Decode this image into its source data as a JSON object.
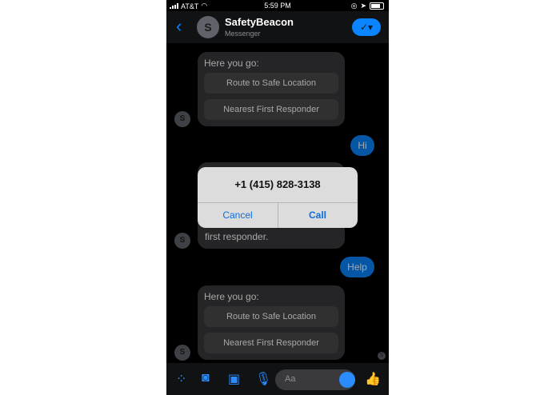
{
  "status": {
    "carrier": "AT&T",
    "time": "5:59 PM"
  },
  "header": {
    "title": "SafetyBeacon",
    "subtitle": "Messenger",
    "avatar_letter": "S"
  },
  "messages": {
    "card1": {
      "label": "Here you go:",
      "buttons": [
        "Route to Safe Location",
        "Nearest First Responder"
      ]
    },
    "hi": "Hi",
    "partial": "first responder.",
    "help": "Help",
    "card2": {
      "label": "Here you go:",
      "buttons": [
        "Route to Safe Location",
        "Nearest First Responder"
      ]
    }
  },
  "alert": {
    "number": "+1 (415) 828-3138",
    "cancel": "Cancel",
    "call": "Call"
  },
  "composer": {
    "placeholder": "Aa"
  },
  "icons": [
    "back-icon",
    "checkmark-icon",
    "grid-icon",
    "camera-icon",
    "gallery-icon",
    "microphone-icon",
    "emoji-icon",
    "thumbs-up-icon"
  ],
  "colors": {
    "accent": "#0a84ff",
    "bubble_in": "#3a3a3c"
  }
}
